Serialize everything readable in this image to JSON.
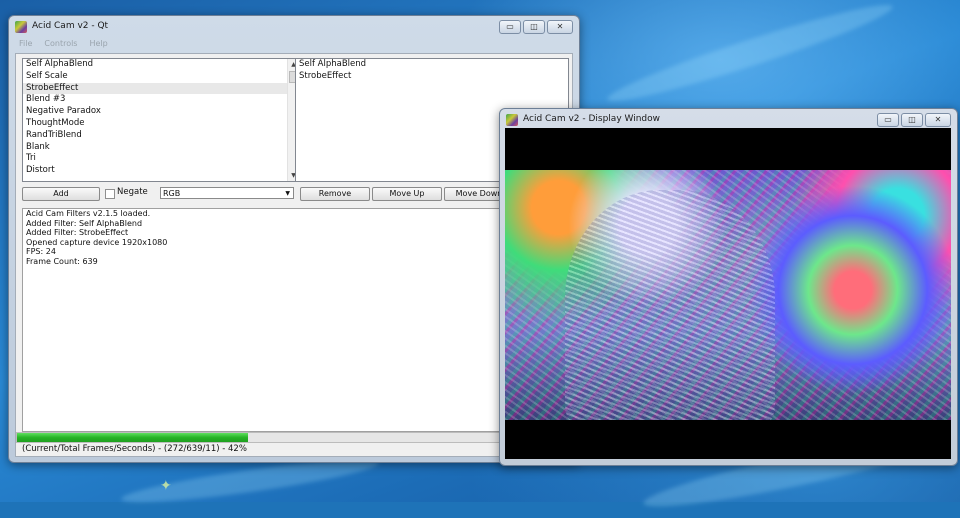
{
  "main_window": {
    "title": "Acid Cam v2 - Qt",
    "menu": [
      "File",
      "Controls",
      "Help"
    ],
    "filter_list": [
      "Self AlphaBlend",
      "Self Scale",
      "StrobeEffect",
      "Blend #3",
      "Negative Paradox",
      "ThoughtMode",
      "RandTriBlend",
      "Blank",
      "Tri",
      "Distort"
    ],
    "filter_list_selected": "StrobeEffect",
    "added_filters": [
      "Self AlphaBlend",
      "StrobeEffect"
    ],
    "add_button": "Add",
    "negate_label": "Negate",
    "negate_checked": false,
    "color_mode": "RGB",
    "remove_button": "Remove",
    "move_up_button": "Move Up",
    "move_down_button": "Move Down",
    "log_lines": [
      "Acid Cam Filters v2.1.5 loaded.",
      "Added Filter: Self AlphaBlend",
      "Added Filter: StrobeEffect",
      "Opened capture device 1920x1080",
      "FPS: 24",
      "Frame Count: 639"
    ],
    "progress_fraction": 0.42,
    "status": "(Current/Total Frames/Seconds) - (272/639/11) - 42%"
  },
  "display_window": {
    "title": "Acid Cam v2 - Display Window"
  },
  "window_controls": {
    "minimize": "▭",
    "maximize": "◫",
    "close": "✕"
  },
  "colors": {
    "progress": "#27b327",
    "desktop": "#1e73b8"
  }
}
